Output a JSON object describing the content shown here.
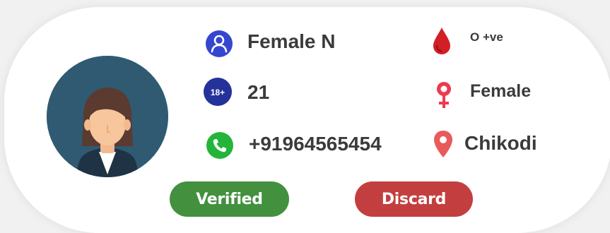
{
  "profile": {
    "name": "Female N",
    "age": "21",
    "age_badge": "18+",
    "phone": "+91964565454",
    "blood_group": "O +ve",
    "gender": "Female",
    "location": "Chikodi"
  },
  "actions": {
    "verified_label": "Verified",
    "discard_label": "Discard"
  },
  "colors": {
    "verified": "#43903f",
    "discard": "#c33f3f",
    "user_icon": "#3546d0",
    "age_icon": "#24329a",
    "phone_icon": "#23b53a",
    "blood_icon": "#d21f26",
    "gender_icon": "#ec3b4e",
    "location_icon": "#e95a5a"
  },
  "icons": {
    "user": "user-circle-icon",
    "age": "age-18-plus-icon",
    "phone": "phone-icon",
    "blood": "blood-drop-icon",
    "gender": "female-symbol-icon",
    "location": "location-pin-icon"
  }
}
